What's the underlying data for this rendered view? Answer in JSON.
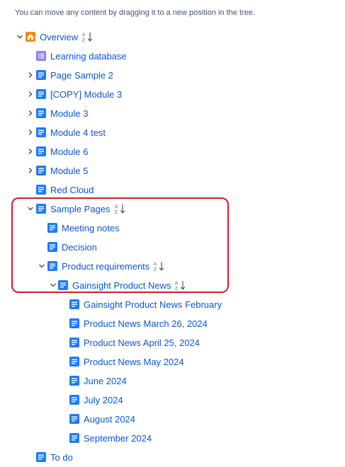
{
  "hint": "You can move any content by dragging it to a new position in the tree.",
  "tree": {
    "overview": {
      "label": "Overview",
      "icon": "home-icon",
      "sortable": true
    },
    "learning_db": {
      "label": "Learning database",
      "icon": "database-icon"
    },
    "page_sample_2": {
      "label": "Page Sample 2",
      "icon": "page-icon"
    },
    "copy_module_3": {
      "label": "[COPY] Module 3",
      "icon": "page-icon"
    },
    "module_3": {
      "label": "Module 3",
      "icon": "page-icon"
    },
    "module_4_test": {
      "label": "Module 4 test",
      "icon": "page-icon"
    },
    "module_6": {
      "label": "Module 6",
      "icon": "page-icon"
    },
    "module_5": {
      "label": "Module 5",
      "icon": "page-icon"
    },
    "red_cloud": {
      "label": "Red Cloud",
      "icon": "page-icon"
    },
    "sample_pages": {
      "label": "Sample Pages",
      "icon": "page-icon",
      "sortable": true
    },
    "meeting_notes": {
      "label": "Meeting notes",
      "icon": "page-icon"
    },
    "decision": {
      "label": "Decision",
      "icon": "page-icon"
    },
    "product_requirements": {
      "label": "Product requirements",
      "icon": "page-icon",
      "sortable": true
    },
    "gainsight_news": {
      "label": "Gainsight Product News",
      "icon": "page-icon",
      "sortable": true
    },
    "gainsight_feb": {
      "label": "Gainsight Product News February",
      "icon": "page-icon"
    },
    "news_mar": {
      "label": "Product News March 26, 2024",
      "icon": "page-icon"
    },
    "news_apr": {
      "label": "Product News April 25, 2024",
      "icon": "page-icon"
    },
    "news_may": {
      "label": "Product News May 2024",
      "icon": "page-icon"
    },
    "june": {
      "label": "June 2024",
      "icon": "page-icon"
    },
    "july": {
      "label": "July 2024",
      "icon": "page-icon"
    },
    "august": {
      "label": "August 2024",
      "icon": "page-icon"
    },
    "september": {
      "label": "September 2024",
      "icon": "page-icon"
    },
    "todo": {
      "label": "To do",
      "icon": "page-icon"
    }
  },
  "colors": {
    "link": "#0c55cc",
    "page_icon": "#1d7afc",
    "home_icon": "#f18d13",
    "database_icon": "#8f7ee7",
    "highlight": "#cc1f2b"
  }
}
